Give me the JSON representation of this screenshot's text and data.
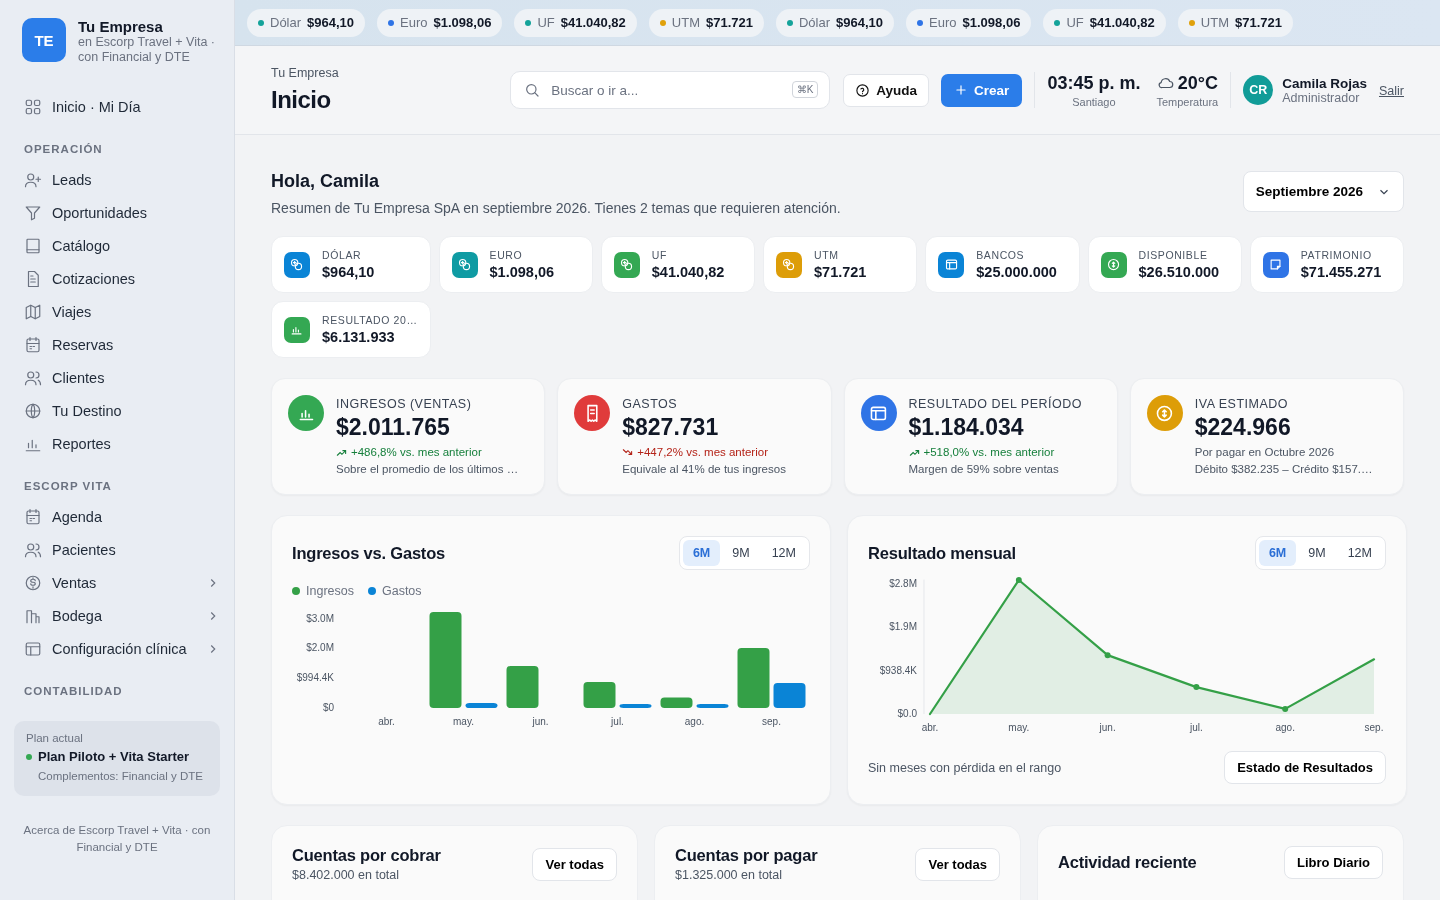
{
  "sidebar": {
    "logo": "TE",
    "company": "Tu Empresa",
    "subtitle": "en Escorp Travel + Vita · con Financial y DTE",
    "home": {
      "label": "Inicio · Mi Día"
    },
    "sections": [
      {
        "title": "OPERACIÓN",
        "items": [
          {
            "label": "Leads",
            "submenu": false
          },
          {
            "label": "Oportunidades",
            "submenu": false
          },
          {
            "label": "Catálogo",
            "submenu": false
          },
          {
            "label": "Cotizaciones",
            "submenu": false
          },
          {
            "label": "Viajes",
            "submenu": false
          },
          {
            "label": "Reservas",
            "submenu": false
          },
          {
            "label": "Clientes",
            "submenu": false
          },
          {
            "label": "Tu Destino",
            "submenu": false
          },
          {
            "label": "Reportes",
            "submenu": false
          }
        ]
      },
      {
        "title": "ESCORP VITA",
        "items": [
          {
            "label": "Agenda",
            "submenu": false
          },
          {
            "label": "Pacientes",
            "submenu": false
          },
          {
            "label": "Ventas",
            "submenu": true
          },
          {
            "label": "Bodega",
            "submenu": true
          },
          {
            "label": "Configuración clínica",
            "submenu": true
          }
        ]
      },
      {
        "title": "CONTABILIDAD"
      }
    ],
    "plan": {
      "caption": "Plan actual",
      "name": "Plan Piloto + Vita Starter",
      "addons": "Complementos: Financial y DTE"
    },
    "footer": "Acerca de Escorp Travel + Vita · con Financial y DTE"
  },
  "ticker": [
    {
      "label": "Dólar",
      "value": "$964,10",
      "color": "#14a39a"
    },
    {
      "label": "Euro",
      "value": "$1.098,06",
      "color": "#2f74e6"
    },
    {
      "label": "UF",
      "value": "$41.040,82",
      "color": "#14a39a"
    },
    {
      "label": "UTM",
      "value": "$71.721",
      "color": "#e0a10b"
    },
    {
      "label": "Dólar",
      "value": "$964,10",
      "color": "#14a39a"
    },
    {
      "label": "Euro",
      "value": "$1.098,06",
      "color": "#2f74e6"
    },
    {
      "label": "UF",
      "value": "$41.040,82",
      "color": "#14a39a"
    },
    {
      "label": "UTM",
      "value": "$71.721",
      "color": "#e0a10b"
    }
  ],
  "header": {
    "breadcrumb": "Tu Empresa",
    "title": "Inicio",
    "search": {
      "placeholder": "Buscar o ir a..."
    },
    "shortcut": "⌘K",
    "help": "Ayuda",
    "create": "Crear",
    "time": "03:45 p. m.",
    "city": "Santiago",
    "temperature": "20°C",
    "temperature_label": "Temperatura",
    "user": {
      "initials": "CR",
      "name": "Camila Rojas",
      "role": "Administrador"
    },
    "logout": "Salir"
  },
  "greeting": {
    "title": "Hola, Camila",
    "summary": "Resumen de Tu Empresa SpA en septiembre 2026. Tienes 2 temas que requieren atención.",
    "period": "Septiembre 2026"
  },
  "tiles": [
    {
      "kind": "currency",
      "label": "DÓLAR",
      "value": "$964,10",
      "color": "#0a84d6"
    },
    {
      "kind": "currency",
      "label": "EURO",
      "value": "$1.098,06",
      "color": "#0f9ba3"
    },
    {
      "kind": "currency",
      "label": "UF",
      "value": "$41.040,82",
      "color": "#34a853"
    },
    {
      "kind": "currency",
      "label": "UTM",
      "value": "$71.721",
      "color": "#dd9d08"
    },
    {
      "kind": "bank",
      "label": "BANCOS",
      "value": "$25.000.000",
      "color": "#0a84d6"
    },
    {
      "kind": "money",
      "label": "DISPONIBLE",
      "value": "$26.510.000",
      "color": "#34a853"
    },
    {
      "kind": "wallet",
      "label": "PATRIMONIO",
      "value": "$71.455.271",
      "color": "#2f74e6"
    },
    {
      "kind": "chart",
      "label": "RESULTADO 20…",
      "value": "$6.131.933",
      "color": "#34a853"
    }
  ],
  "kpis": [
    {
      "kind": "chart",
      "label": "INGRESOS (VENTAS)",
      "value": "$2.011.765",
      "color": "#34a853",
      "trend": {
        "rising": true,
        "text": "+486,8% vs. mes anterior"
      },
      "notes": [
        "Sobre el promedio de los últimos …"
      ]
    },
    {
      "kind": "receipt",
      "label": "GASTOS",
      "value": "$827.731",
      "color": "#e03b3b",
      "trend": {
        "rising": false,
        "text": "+447,2% vs. mes anterior"
      },
      "notes": [
        "Equivale al 41% de tus ingresos"
      ]
    },
    {
      "kind": "bank",
      "label": "RESULTADO DEL PERÍODO",
      "value": "$1.184.034",
      "color": "#2f74e6",
      "trend": {
        "rising": true,
        "text": "+518,0% vs. mes anterior"
      },
      "notes": [
        "Margen de 59% sobre ventas"
      ]
    },
    {
      "kind": "money",
      "label": "IVA ESTIMADO",
      "value": "$224.966",
      "color": "#dd9d08",
      "notes": [
        "Por pagar en Octubre 2026",
        "Débito $382.235 – Crédito $157.…"
      ]
    }
  ],
  "charts": [
    {
      "title": "Ingresos vs. Gastos",
      "ranges": [
        {
          "label": "6M",
          "selected": true
        },
        {
          "label": "9M",
          "selected": false
        },
        {
          "label": "12M",
          "selected": false
        }
      ],
      "chart_data": {
        "type": "bar",
        "categories": [
          "abr.",
          "may.",
          "jun.",
          "jul.",
          "ago.",
          "sep."
        ],
        "series": [
          {
            "name": "Ingresos",
            "color": "#34a047",
            "values": [
              0,
              3200000,
              1400000,
              870000,
              350000,
              2000000
            ]
          },
          {
            "name": "Gastos",
            "color": "#0a84d6",
            "values": [
              0,
              170000,
              0,
              130000,
              130000,
              830000
            ]
          }
        ],
        "ylim": [
          0,
          3300000
        ],
        "yticks": [
          {
            "value": 0,
            "label": "$0"
          },
          {
            "value": 994400,
            "label": "$994.4K"
          },
          {
            "value": 1988800,
            "label": "$2.0M"
          },
          {
            "value": 2983200,
            "label": "$3.0M"
          }
        ]
      }
    },
    {
      "title": "Resultado mensual",
      "ranges": [
        {
          "label": "6M",
          "selected": true
        },
        {
          "label": "9M",
          "selected": false
        },
        {
          "label": "12M",
          "selected": false
        }
      ],
      "chart_data": {
        "type": "area",
        "categories": [
          "abr.",
          "may.",
          "jun.",
          "jul.",
          "ago.",
          "sep."
        ],
        "series": [
          {
            "color": "#34a047",
            "values": [
              0,
              2890000,
              1270000,
              580000,
              110000,
              1180000
            ]
          }
        ],
        "ylim": [
          0,
          2900000
        ],
        "yticks": [
          {
            "value": 0,
            "label": "$0.0"
          },
          {
            "value": 938400,
            "label": "$938.4K"
          },
          {
            "value": 1876800,
            "label": "$1.9M"
          },
          {
            "value": 2815200,
            "label": "$2.8M"
          }
        ]
      },
      "note": "Sin meses con pérdida en el rango",
      "action": "Estado de Resultados"
    }
  ],
  "panels": [
    {
      "title": "Cuentas por cobrar",
      "subtitle": "$8.402.000 en total",
      "action": "Ver todas"
    },
    {
      "title": "Cuentas por pagar",
      "subtitle": "$1.325.000 en total",
      "action": "Ver todas"
    },
    {
      "title": "Actividad reciente",
      "action": "Libro Diario"
    }
  ]
}
